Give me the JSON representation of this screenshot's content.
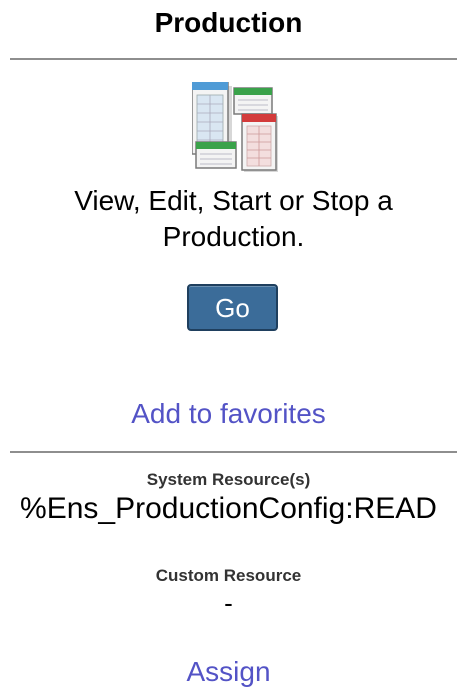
{
  "panel": {
    "title": "Production",
    "icon": "production-windows-icon",
    "description": "View, Edit, Start or Stop a Production.",
    "go_label": "Go",
    "favorites_label": "Add to favorites"
  },
  "resources": {
    "system_label": "System Resource(s)",
    "system_value": "%Ens_ProductionConfig:READ",
    "custom_label": "Custom Resource",
    "custom_value": "-",
    "assign_label": "Assign"
  },
  "colors": {
    "link": "#5353c6",
    "button": "#3b6c99",
    "rule": "#8e8e8e"
  }
}
